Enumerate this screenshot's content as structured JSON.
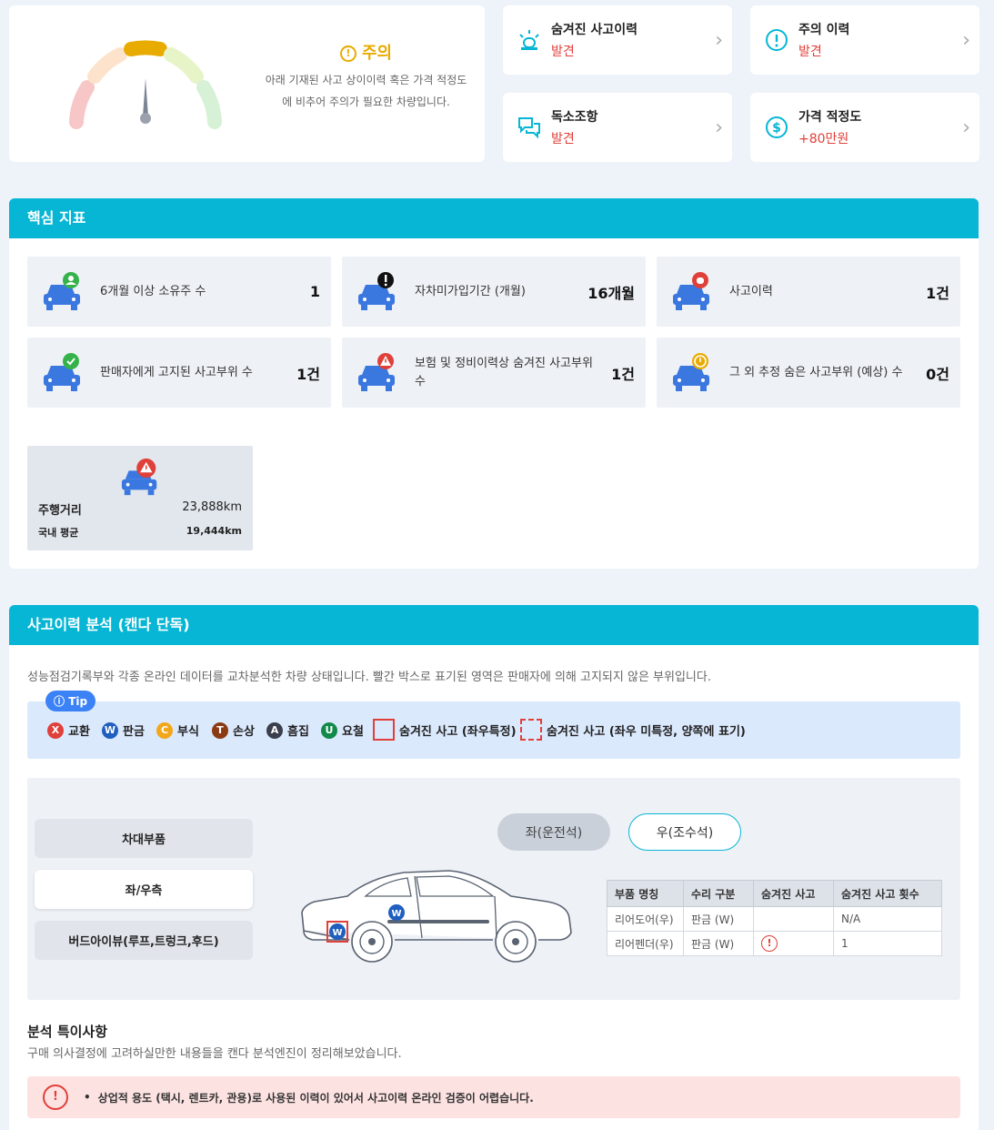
{
  "verdict": {
    "title": "주의",
    "description": "아래 기재된 사고 상이이력 혹은 가격 적정도에 비추어 주의가 필요한 차량입니다.",
    "icon": "caution-icon",
    "colors": {
      "caution": "#e8ab00",
      "danger": "#e0403a",
      "safe": "#4caf50"
    }
  },
  "status_cards": [
    {
      "label": "숨겨진 사고이력",
      "value": "발견",
      "icon": "siren-icon"
    },
    {
      "label": "주의 이력",
      "value": "발견",
      "icon": "caution-icon"
    },
    {
      "label": "독소조항",
      "value": "발견",
      "icon": "chat-icon"
    },
    {
      "label": "가격 적정도",
      "value": "+80만원",
      "icon": "dollar-icon"
    }
  ],
  "core": {
    "title": "핵심 지표",
    "items": [
      {
        "label": "6개월 이상 소유주 수",
        "value": "1",
        "badge": "user-badge-icon"
      },
      {
        "label": "자차미가입기간 (개월)",
        "value": "16개월",
        "badge": "exclamation-badge-icon"
      },
      {
        "label": "사고이력",
        "value": "1건",
        "badge": "siren-badge-icon"
      },
      {
        "label": "판매자에게 고지된 사고부위 수",
        "value": "1건",
        "badge": "check-badge-icon"
      },
      {
        "label": "보험 및 정비이력상 숨겨진 사고부위 수",
        "value": "1건",
        "badge": "warning-badge-icon"
      },
      {
        "label": "그 외 추정 숨은 사고부위 (예상) 수",
        "value": "0건",
        "badge": "caution-badge-icon"
      }
    ],
    "mileage": {
      "label": "주행거리",
      "value": "23,888km",
      "avg_label": "국내 평균",
      "avg_value": "19,444km"
    }
  },
  "accident": {
    "title": "사고이력 분석 (캔다 단독)",
    "description": "성능점검기록부와 각종 온라인 데이터를 교차분석한 차량 상태입니다. 빨간 박스로 표기된 영역은 판매자에 의해 고지되지 않은 부위입니다.",
    "tip": "Tip",
    "legend": [
      {
        "code": "X",
        "label": "교환",
        "color": "#e0403a"
      },
      {
        "code": "W",
        "label": "판금",
        "color": "#1f5fbf"
      },
      {
        "code": "C",
        "label": "부식",
        "color": "#f2a71b"
      },
      {
        "code": "T",
        "label": "손상",
        "color": "#8b3a12"
      },
      {
        "code": "A",
        "label": "흠집",
        "color": "#3a3f4b"
      },
      {
        "code": "U",
        "label": "요철",
        "color": "#118a4a"
      }
    ],
    "hidden_solid": "숨겨진 사고 (좌우특정)",
    "hidden_dashed": "숨겨진 사고 (좌우 미특정, 양쪽에 표기)",
    "part_tabs": [
      "차대부품",
      "좌/우측",
      "버드아이뷰(루프,트렁크,후드)"
    ],
    "sides": [
      "좌(운전석)",
      "우(조수석)"
    ],
    "car_marks": [
      "W",
      "W"
    ],
    "table": {
      "headers": [
        "부품 명칭",
        "수리 구분",
        "숨겨진 사고",
        "숨겨진 사고 횟수"
      ],
      "rows": [
        {
          "part": "리어도어(우)",
          "repair": "판금 (W)",
          "hidden": "",
          "count": "N/A"
        },
        {
          "part": "리어펜더(우)",
          "repair": "판금 (W)",
          "hidden": "!",
          "count": "1"
        }
      ]
    },
    "notes_title": "분석 특이사항",
    "notes_desc": "구매 의사결정에 고려하실만한 내용들을 캔다 분석엔진이 정리해보았습니다.",
    "warning": "상업적 용도 (택시, 렌트카, 관용)로 사용된 이력이 있어서 사고이력 온라인 검증이 어렵습니다."
  }
}
